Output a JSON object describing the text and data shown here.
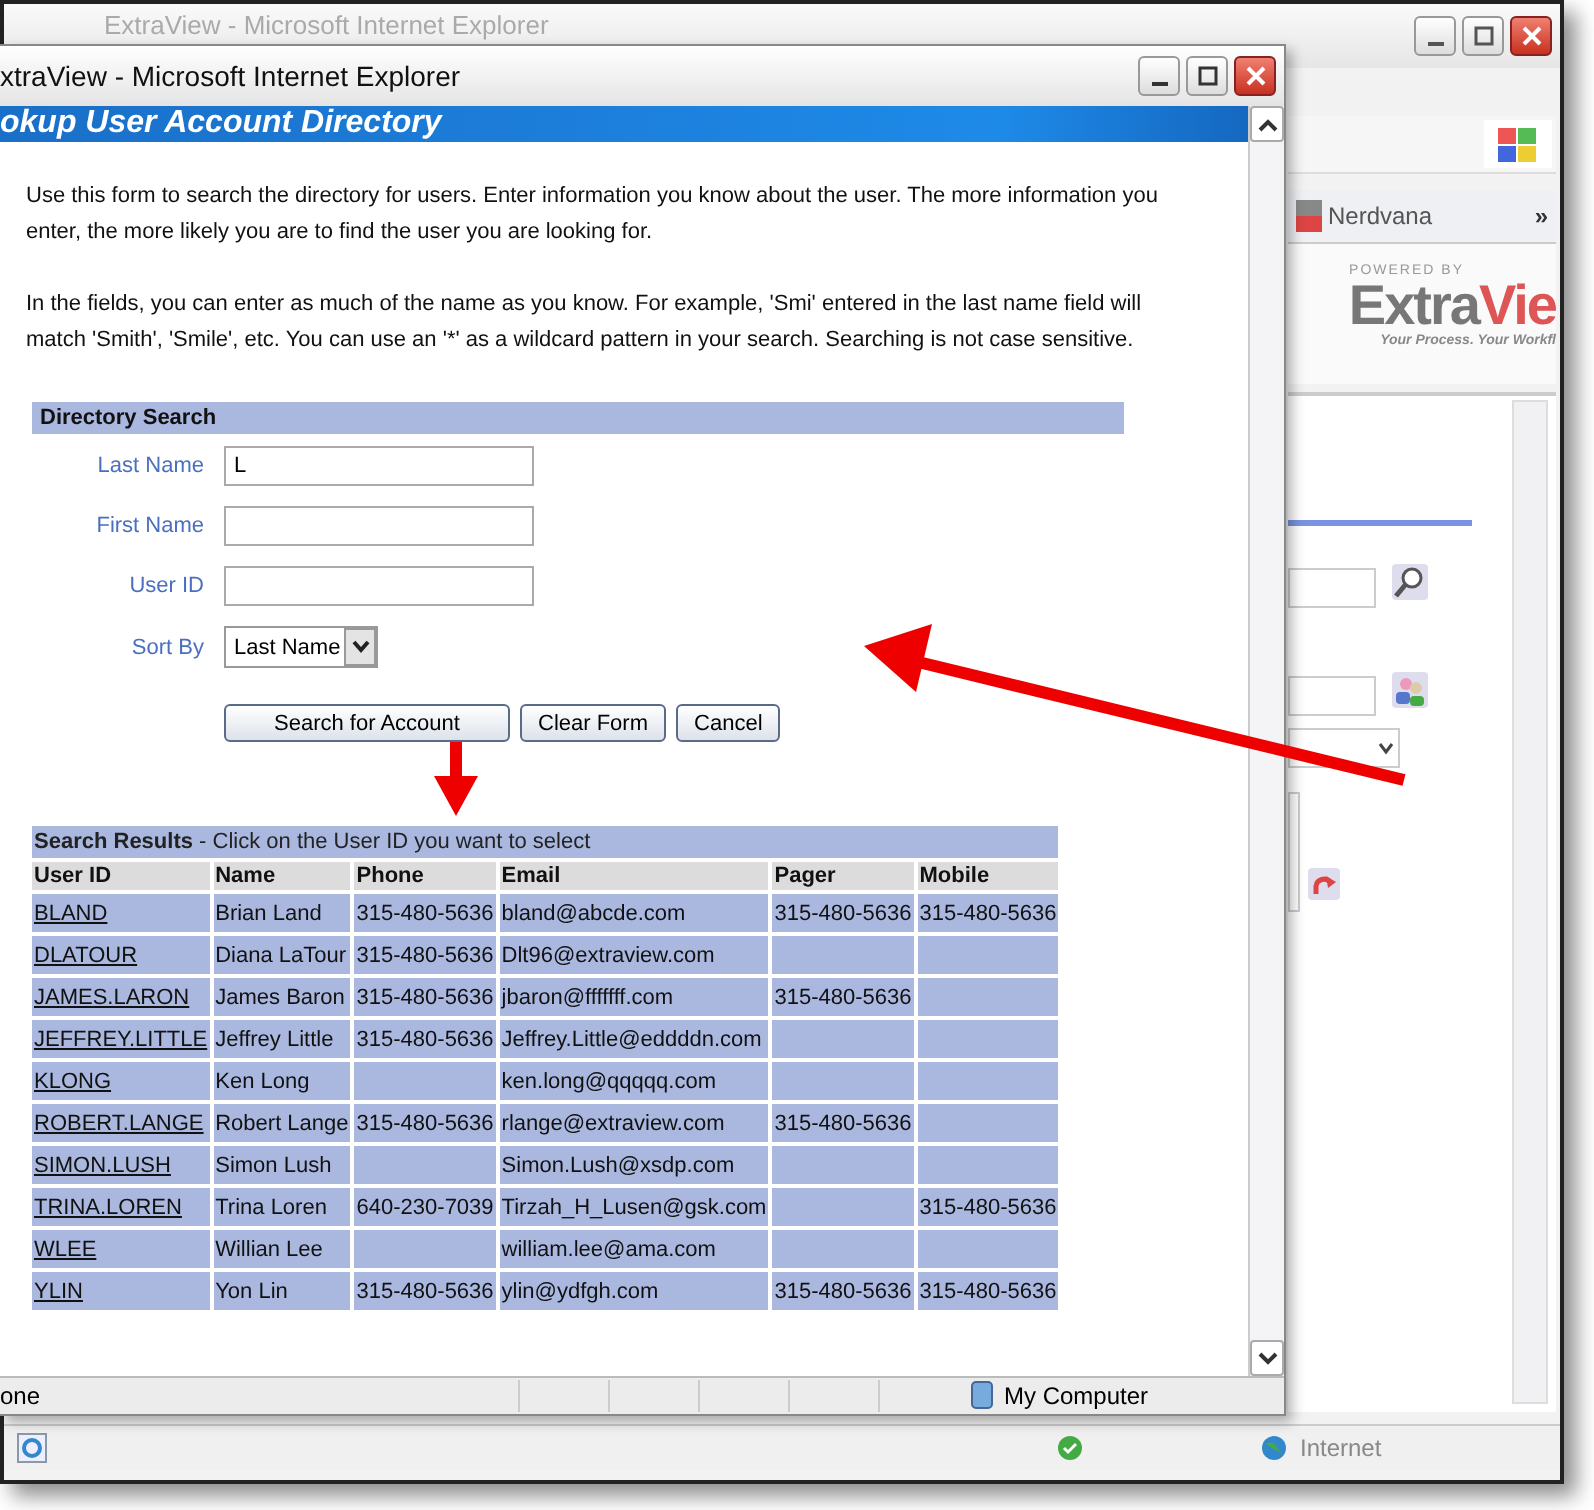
{
  "background_window": {
    "title": "ExtraView - Microsoft Internet Explorer",
    "toolbar_tab": "Nerdvana",
    "chevron": "»",
    "logo": {
      "powered": "POWERED BY",
      "name_gray": "Extra",
      "name_red": "Vie",
      "slogan": "Your Process. Your Workfl"
    },
    "status_zone": "Internet"
  },
  "popup": {
    "title": "xtraView - Microsoft Internet Explorer",
    "header": "okup User Account Directory",
    "intro": [
      "Use this form to search the directory for users. Enter information you know about the user. The more information you enter, the more likely you are to find the user you are looking for.",
      "In the fields, you can enter as much of the name as you know. For example, 'Smi' entered in the last name field will match 'Smith', 'Smile', etc. You can use an '*' as a wildcard pattern in your search. Searching is not case sensitive."
    ],
    "form": {
      "heading": "Directory Search",
      "fields": [
        {
          "label": "Last Name",
          "value": "L"
        },
        {
          "label": "First Name"
        },
        {
          "label": "User ID"
        }
      ],
      "sort": {
        "label": "Sort By",
        "value": "Last Name"
      },
      "buttons": [
        "Search for Account",
        "Clear Form",
        "Cancel"
      ]
    },
    "results": {
      "heading": "**Search Results** - Click on the User ID you want to select",
      "columns": [
        "User ID",
        "Name",
        "Phone",
        "Email",
        "Pager",
        "Mobile"
      ],
      "rows": [
        [
          "BLAND",
          "Brian Land",
          "315-480-5636",
          "bland@abcde.com",
          "315-480-5636",
          "315-480-5636"
        ],
        [
          "DLATOUR",
          "Diana LaTour",
          "315-480-5636",
          "Dlt96@extraview.com",
          "",
          ""
        ],
        [
          "JAMES.LARON",
          "James Baron",
          "315-480-5636",
          "jbaron@fffffff.com",
          "315-480-5636",
          ""
        ],
        [
          "JEFFREY.LITTLE",
          "Jeffrey Little",
          "315-480-5636",
          "Jeffrey.Little@eddddn.com",
          "",
          ""
        ],
        [
          "KLONG",
          "Ken Long",
          "",
          "ken.long@qqqqq.com",
          "",
          ""
        ],
        [
          "ROBERT.LANGE",
          "Robert Lange",
          "315-480-5636",
          "rlange@extraview.com",
          "315-480-5636",
          ""
        ],
        [
          "SIMON.LUSH",
          "Simon Lush",
          "",
          "Simon.Lush@xsdp.com",
          "",
          ""
        ],
        [
          "TRINA.LOREN",
          "Trina Loren",
          "640-230-7039",
          "Tirzah_H_Lusen@gsk.com",
          "",
          "315-480-5636"
        ],
        [
          "WLEE",
          "Willian Lee",
          "",
          "william.lee@ama.com",
          "",
          ""
        ],
        [
          "YLIN",
          "Yon Lin",
          "315-480-5636",
          "ylin@ydfgh.com",
          "315-480-5636",
          "315-480-5636"
        ]
      ]
    },
    "status_left": "one",
    "status_zone": "My Computer"
  }
}
